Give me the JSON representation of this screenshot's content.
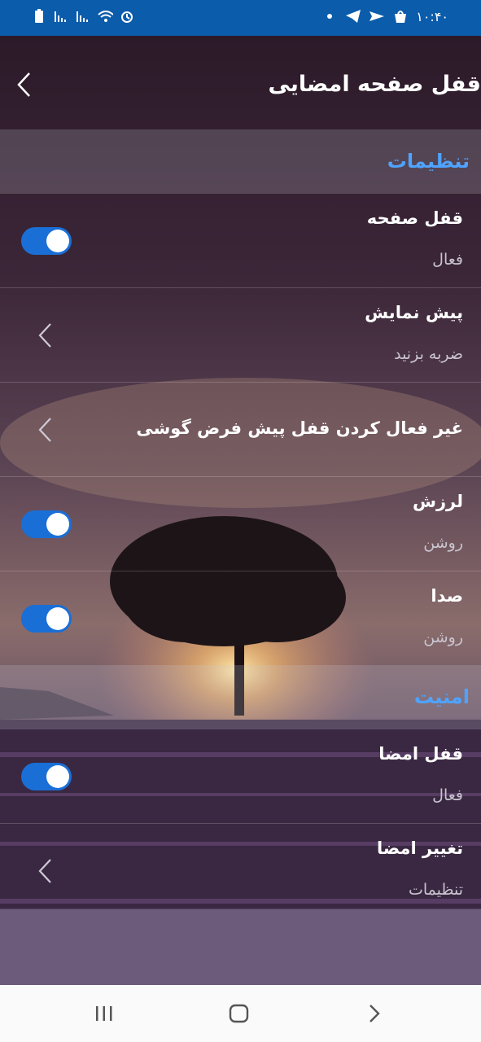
{
  "status_bar": {
    "time": "۱۰:۴۰"
  },
  "header": {
    "title": "قفل صفحه امضایی"
  },
  "sections": {
    "settings": "تنظیمات",
    "security": "امنیت"
  },
  "rows": {
    "screen_lock": {
      "title": "قفل صفحه",
      "subtitle": "فعال"
    },
    "preview": {
      "title": "پیش نمایش",
      "subtitle": "ضربه بزنید"
    },
    "disable_default_lock": {
      "title": "غیر فعال کردن قفل پیش فرض گوشی"
    },
    "vibration": {
      "title": "لرزش",
      "subtitle": "روشن"
    },
    "sound": {
      "title": "صدا",
      "subtitle": "روشن"
    },
    "signature_lock": {
      "title": "قفل امضا",
      "subtitle": "فعال"
    },
    "change_signature": {
      "title": "تغییر امضا",
      "subtitle": "تنظیمات"
    }
  },
  "colors": {
    "status_bar": "#0b5cab",
    "accent": "#4fa3ff",
    "toggle_on": "#1a6fd6"
  },
  "icons": [
    "back-chevron-icon",
    "chevron-left-icon",
    "recents-icon",
    "home-icon",
    "back-icon"
  ]
}
